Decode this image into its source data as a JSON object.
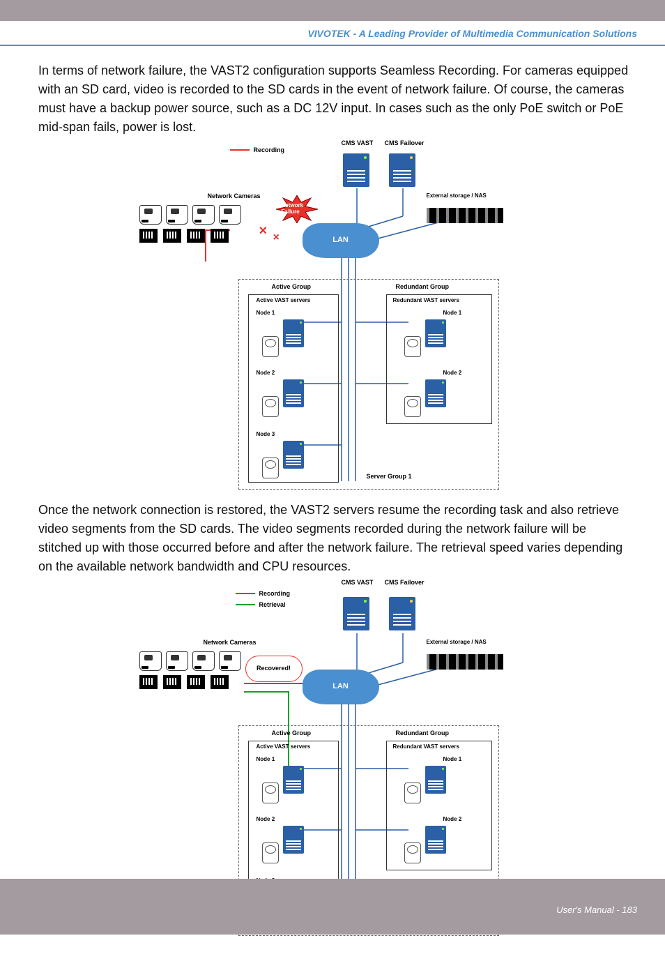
{
  "header": {
    "tagline": "VIVOTEK - A Leading Provider of Multimedia Communication Solutions"
  },
  "para1": "In terms of network failure, the VAST2 configuration supports Seamless Recording. For cameras equipped with an SD card, video is recorded to the SD cards in the event of network failure. Of course, the cameras must have a backup power source, such as a DC 12V input. In cases such as the only PoE switch or PoE mid-span fails, power is lost.",
  "para2": "Once the network connection is restored, the VAST2 servers resume the recording task and also retrieve video segments from the SD cards. The video segments recorded during the network failure will be stitched up with those occurred before and after the network failure. The retrieval speed varies depending on the available network bandwidth and CPU resources.",
  "diagram_common": {
    "cms_vast": "CMS VAST",
    "cms_failover": "CMS Failover",
    "net_cameras": "Network Cameras",
    "ext_storage": "External storage / NAS",
    "lan": "LAN",
    "active_group": "Active Group",
    "redundant_group": "Redundant Group",
    "active_servers": "Active VAST servers",
    "redundant_servers": "Redundant VAST servers",
    "node1": "Node 1",
    "node2": "Node 2",
    "node3": "Node 3",
    "server_group": "Server Group 1",
    "recording": "Recording"
  },
  "diagram1": {
    "net_failure": "Network Failure"
  },
  "diagram2": {
    "retrieval": "Retrieval",
    "recovered": "Recovered!"
  },
  "footer": {
    "text": "User's Manual - 183"
  }
}
